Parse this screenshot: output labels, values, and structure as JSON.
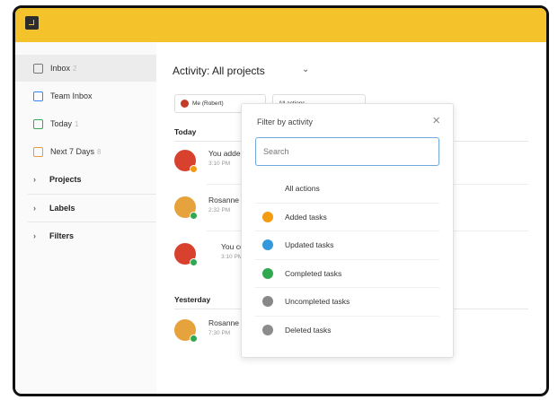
{
  "sidebar": {
    "items": [
      {
        "label": "Inbox",
        "caret": "2"
      },
      {
        "label": "Team Inbox",
        "caret": ""
      },
      {
        "label": "Today",
        "caret": "1"
      },
      {
        "label": "Next 7 Days",
        "caret": "8"
      },
      {
        "label": "Projects"
      },
      {
        "label": "Labels"
      },
      {
        "label": "Filters"
      }
    ]
  },
  "main": {
    "title": "Activity: All projects",
    "title_chevron": "⌄",
    "filters": {
      "me_label": "Me (Robert)",
      "actions_label": "All actions"
    },
    "sections": {
      "today": "Today",
      "yesterday": "Yesterday"
    },
    "activities": [
      {
        "text": "You added",
        "time": "3:10 PM"
      },
      {
        "text": "Rosanne c",
        "time": "2:32 PM"
      },
      {
        "text": "You cor",
        "time": "3:10 PM"
      },
      {
        "text": "Rosanne c",
        "time": "7:30 PM"
      }
    ]
  },
  "popup": {
    "title": "Filter by activity",
    "close": "×",
    "search_placeholder": "Search",
    "items": [
      {
        "label": "All actions"
      },
      {
        "label": "Added tasks"
      },
      {
        "label": "Updated tasks"
      },
      {
        "label": "Completed tasks"
      },
      {
        "label": "Uncompleted tasks"
      },
      {
        "label": "Deleted tasks"
      }
    ]
  },
  "colors": {
    "topbar": "#f4c22b",
    "added": "#f39c12",
    "updated": "#3498db",
    "completed": "#2fa84f",
    "neutral": "#888888"
  }
}
